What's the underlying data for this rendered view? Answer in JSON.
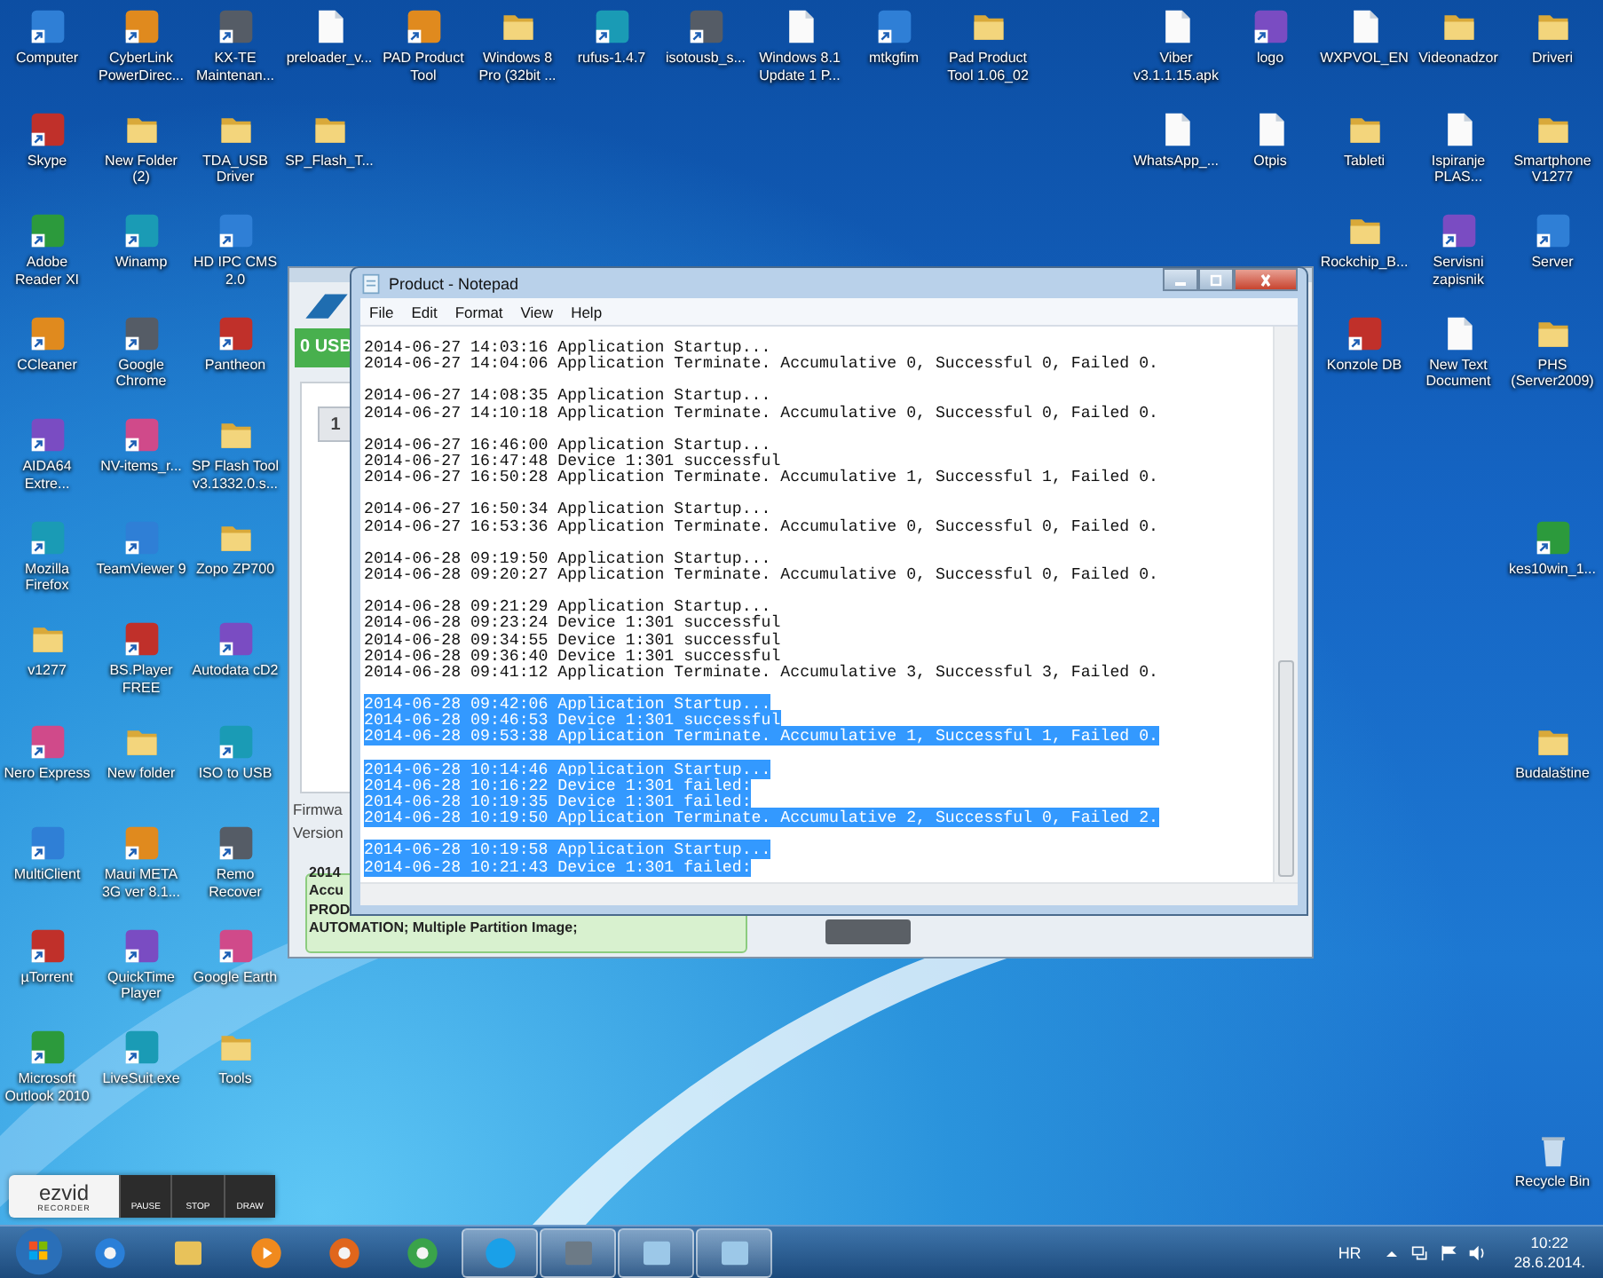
{
  "desktop_icons": [
    {
      "label": "Computer",
      "kind": "app"
    },
    {
      "label": "Skype",
      "kind": "app"
    },
    {
      "label": "Adobe Reader XI",
      "kind": "app"
    },
    {
      "label": "CCleaner",
      "kind": "app"
    },
    {
      "label": "AIDA64 Extre...",
      "kind": "app"
    },
    {
      "label": "Mozilla Firefox",
      "kind": "app"
    },
    {
      "label": "v1277",
      "kind": "folder"
    },
    {
      "label": "Nero Express",
      "kind": "app"
    },
    {
      "label": "MultiClient",
      "kind": "app"
    },
    {
      "label": "µTorrent",
      "kind": "app"
    },
    {
      "label": "Microsoft Outlook 2010",
      "kind": "app"
    },
    {
      "label": "CyberLink PowerDirec...",
      "kind": "app"
    },
    {
      "label": "New Folder (2)",
      "kind": "folder"
    },
    {
      "label": "Winamp",
      "kind": "app"
    },
    {
      "label": "Google Chrome",
      "kind": "app"
    },
    {
      "label": "NV-items_r...",
      "kind": "app"
    },
    {
      "label": "TeamViewer 9",
      "kind": "app"
    },
    {
      "label": "BS.Player FREE",
      "kind": "app"
    },
    {
      "label": "New folder",
      "kind": "folder"
    },
    {
      "label": "Maui META 3G ver 8.1...",
      "kind": "app"
    },
    {
      "label": "QuickTime Player",
      "kind": "app"
    },
    {
      "label": "LiveSuit.exe",
      "kind": "app"
    },
    {
      "label": "KX-TE Maintenan...",
      "kind": "app"
    },
    {
      "label": "TDA_USB Driver",
      "kind": "folder"
    },
    {
      "label": "HD IPC CMS 2.0",
      "kind": "app"
    },
    {
      "label": "Pantheon",
      "kind": "app"
    },
    {
      "label": "SP Flash Tool v3.1332.0.s...",
      "kind": "folder"
    },
    {
      "label": "Zopo ZP700",
      "kind": "folder"
    },
    {
      "label": "Autodata cD2",
      "kind": "app"
    },
    {
      "label": "ISO to USB",
      "kind": "app"
    },
    {
      "label": "Remo Recover",
      "kind": "app"
    },
    {
      "label": "Google Earth",
      "kind": "app"
    },
    {
      "label": "Tools",
      "kind": "folder"
    },
    {
      "label": "preloader_v...",
      "kind": "file"
    },
    {
      "label": "SP_Flash_T...",
      "kind": "folder"
    },
    {
      "label": "PAD Product Tool",
      "kind": "app"
    },
    {
      "label": "Windows 8 Pro (32bit ...",
      "kind": "folder"
    },
    {
      "label": "rufus-1.4.7",
      "kind": "app"
    },
    {
      "label": "isotousb_s...",
      "kind": "app"
    },
    {
      "label": "Windows 8.1 Update 1 P...",
      "kind": "file"
    },
    {
      "label": "mtkgfim",
      "kind": "app"
    },
    {
      "label": "Pad Product Tool 1.06_02",
      "kind": "folder"
    },
    {
      "label": "Viber v3.1.1.15.apk",
      "kind": "file"
    },
    {
      "label": "WhatsApp_...",
      "kind": "file"
    },
    {
      "label": "logo",
      "kind": "app"
    },
    {
      "label": "Otpis",
      "kind": "file"
    },
    {
      "label": "WXPVOL_EN",
      "kind": "file"
    },
    {
      "label": "Tableti",
      "kind": "folder"
    },
    {
      "label": "Rockchip_B...",
      "kind": "folder"
    },
    {
      "label": "Konzole DB",
      "kind": "app"
    },
    {
      "label": "Videonadzor",
      "kind": "folder"
    },
    {
      "label": "Ispiranje PLAS...",
      "kind": "file"
    },
    {
      "label": "Servisni zapisnik",
      "kind": "app"
    },
    {
      "label": "New Text Document",
      "kind": "file"
    },
    {
      "label": "Driveri",
      "kind": "folder"
    },
    {
      "label": "Smartphone V1277",
      "kind": "folder"
    },
    {
      "label": "Server",
      "kind": "app"
    },
    {
      "label": "PHS (Server2009)",
      "kind": "folder"
    },
    {
      "label": "kes10win_1...",
      "kind": "app"
    },
    {
      "label": "Budalaštine",
      "kind": "folder"
    },
    {
      "label": "Recycle Bin",
      "kind": "recycle"
    }
  ],
  "background_app": {
    "status": "0 USB",
    "tab": "1",
    "labels": [
      "Firmwa",
      "Version"
    ],
    "log_lines": [
      "2014",
      "Accu",
      "PROD",
      "AUTOMATION; Multiple Partition Image;"
    ]
  },
  "notepad": {
    "title": "Product - Notepad",
    "menu": [
      "File",
      "Edit",
      "Format",
      "View",
      "Help"
    ],
    "groups": [
      {
        "selected": false,
        "lines": [
          "2014-06-27 14:03:16 Application Startup...",
          "2014-06-27 14:04:06 Application Terminate. Accumulative 0, Successful 0, Failed 0."
        ]
      },
      {
        "selected": false,
        "lines": [
          "2014-06-27 14:08:35 Application Startup...",
          "2014-06-27 14:10:18 Application Terminate. Accumulative 0, Successful 0, Failed 0."
        ]
      },
      {
        "selected": false,
        "lines": [
          "2014-06-27 16:46:00 Application Startup...",
          "2014-06-27 16:47:48 Device 1:301 successful",
          "2014-06-27 16:50:28 Application Terminate. Accumulative 1, Successful 1, Failed 0."
        ]
      },
      {
        "selected": false,
        "lines": [
          "2014-06-27 16:50:34 Application Startup...",
          "2014-06-27 16:53:36 Application Terminate. Accumulative 0, Successful 0, Failed 0."
        ]
      },
      {
        "selected": false,
        "lines": [
          "2014-06-28 09:19:50 Application Startup...",
          "2014-06-28 09:20:27 Application Terminate. Accumulative 0, Successful 0, Failed 0."
        ]
      },
      {
        "selected": false,
        "lines": [
          "2014-06-28 09:21:29 Application Startup...",
          "2014-06-28 09:23:24 Device 1:301 successful",
          "2014-06-28 09:34:55 Device 1:301 successful",
          "2014-06-28 09:36:40 Device 1:301 successful",
          "2014-06-28 09:41:12 Application Terminate. Accumulative 3, Successful 3, Failed 0."
        ]
      },
      {
        "selected": true,
        "lines": [
          "2014-06-28 09:42:06 Application Startup...",
          "2014-06-28 09:46:53 Device 1:301 successful",
          "2014-06-28 09:53:38 Application Terminate. Accumulative 1, Successful 1, Failed 0."
        ]
      },
      {
        "selected": true,
        "lines": [
          "2014-06-28 10:14:46 Application Startup...",
          "2014-06-28 10:16:22 Device 1:301 failed:",
          "2014-06-28 10:19:35 Device 1:301 failed:",
          "2014-06-28 10:19:50 Application Terminate. Accumulative 2, Successful 0, Failed 2."
        ]
      },
      {
        "selected": true,
        "lines": [
          "2014-06-28 10:19:58 Application Startup...",
          "2014-06-28 10:21:43 Device 1:301 failed:"
        ]
      }
    ]
  },
  "recorder": {
    "logo": "ezvid",
    "subtitle": "RECORDER",
    "buttons": [
      "PAUSE",
      "STOP",
      "DRAW"
    ]
  },
  "taskbar": {
    "items": [
      {
        "kind": "ie",
        "running": false
      },
      {
        "kind": "explorer",
        "running": false
      },
      {
        "kind": "media",
        "running": false
      },
      {
        "kind": "firefox",
        "running": false
      },
      {
        "kind": "chrome",
        "running": false
      },
      {
        "kind": "skype",
        "running": true
      },
      {
        "kind": "app",
        "running": true
      },
      {
        "kind": "notepad",
        "running": true
      },
      {
        "kind": "notepad",
        "running": true
      }
    ],
    "language": "HR",
    "time": "10:22",
    "date": "28.6.2014."
  }
}
